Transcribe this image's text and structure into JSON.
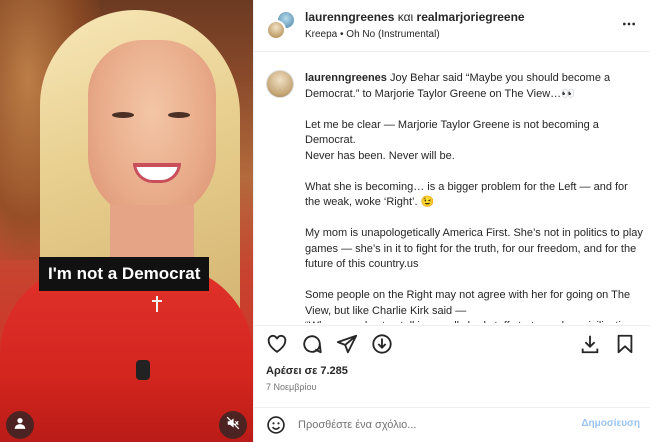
{
  "header": {
    "user1": "laurenngreenes",
    "conjunction": "και",
    "user2": "realmarjoriegreene",
    "audio": "Kreepa • Oh No (Instrumental)"
  },
  "media": {
    "caption": "I'm not a Democrat"
  },
  "post": {
    "username": "laurenngreenes",
    "paragraphs": [
      "Joy Behar said “Maybe you should become a Democrat.” to Marjorie Taylor Greene on The View…👀",
      "Let me be clear — Marjorie Taylor Greene is not becoming a Democrat.\nNever has been. Never will be.",
      "What she is becoming… is a bigger problem for the Left — and for the weak, woke ‘Right’. 😉",
      "My mom is unapologetically America First. She’s not in politics to play games — she’s in it to fight for the truth, for our freedom, and for the future of this country.us",
      "Some people on the Right may not agree with her for going on The View, but like Charlie Kirk said —\n“When people stop talking, really bad stuff starts… when civilization stops talking with each other…”"
    ]
  },
  "stats": {
    "likes": "Αρέσει σε 7.285",
    "date": "7 Νοεμβρίου"
  },
  "composer": {
    "placeholder": "Προσθέστε ένα σχόλιο...",
    "publish": "Δημοσίευση"
  },
  "colors": {
    "accent": "#0095f6",
    "publish_disabled": "#9bc4f3",
    "caption_bg": "#111111"
  },
  "icons": [
    "user-icon",
    "mute-icon",
    "more-icon",
    "heart-icon",
    "comment-icon",
    "share-icon",
    "repost-icon",
    "download-icon",
    "bookmark-icon",
    "emoji-icon"
  ]
}
